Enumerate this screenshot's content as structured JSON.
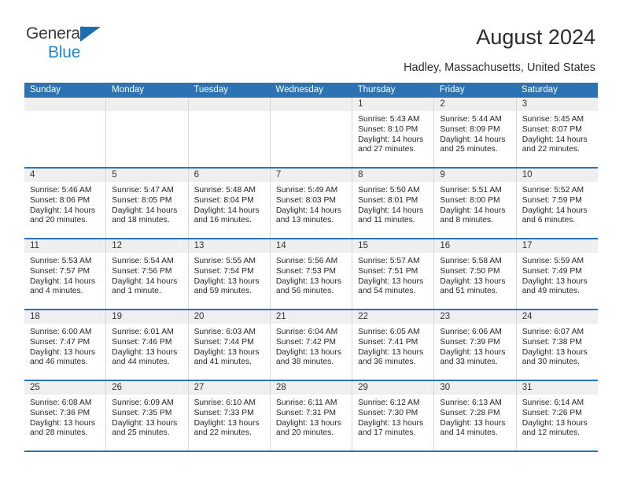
{
  "brand": {
    "name_top": "General",
    "name_bottom": "Blue",
    "accent_color": "#1e87d6",
    "triangle_color": "#1a6fb4"
  },
  "header": {
    "title": "August 2024",
    "subtitle": "Hadley, Massachusetts, United States"
  },
  "theme": {
    "header_blue": "#2b73b3",
    "daynum_band": "#efefef",
    "cell_border": "#d8d8d8"
  },
  "weekdays": [
    "Sunday",
    "Monday",
    "Tuesday",
    "Wednesday",
    "Thursday",
    "Friday",
    "Saturday"
  ],
  "weeks": [
    [
      {
        "day": "",
        "sunrise": "",
        "sunset": "",
        "daylight": ""
      },
      {
        "day": "",
        "sunrise": "",
        "sunset": "",
        "daylight": ""
      },
      {
        "day": "",
        "sunrise": "",
        "sunset": "",
        "daylight": ""
      },
      {
        "day": "",
        "sunrise": "",
        "sunset": "",
        "daylight": ""
      },
      {
        "day": "1",
        "sunrise": "Sunrise: 5:43 AM",
        "sunset": "Sunset: 8:10 PM",
        "daylight": "Daylight: 14 hours and 27 minutes."
      },
      {
        "day": "2",
        "sunrise": "Sunrise: 5:44 AM",
        "sunset": "Sunset: 8:09 PM",
        "daylight": "Daylight: 14 hours and 25 minutes."
      },
      {
        "day": "3",
        "sunrise": "Sunrise: 5:45 AM",
        "sunset": "Sunset: 8:07 PM",
        "daylight": "Daylight: 14 hours and 22 minutes."
      }
    ],
    [
      {
        "day": "4",
        "sunrise": "Sunrise: 5:46 AM",
        "sunset": "Sunset: 8:06 PM",
        "daylight": "Daylight: 14 hours and 20 minutes."
      },
      {
        "day": "5",
        "sunrise": "Sunrise: 5:47 AM",
        "sunset": "Sunset: 8:05 PM",
        "daylight": "Daylight: 14 hours and 18 minutes."
      },
      {
        "day": "6",
        "sunrise": "Sunrise: 5:48 AM",
        "sunset": "Sunset: 8:04 PM",
        "daylight": "Daylight: 14 hours and 16 minutes."
      },
      {
        "day": "7",
        "sunrise": "Sunrise: 5:49 AM",
        "sunset": "Sunset: 8:03 PM",
        "daylight": "Daylight: 14 hours and 13 minutes."
      },
      {
        "day": "8",
        "sunrise": "Sunrise: 5:50 AM",
        "sunset": "Sunset: 8:01 PM",
        "daylight": "Daylight: 14 hours and 11 minutes."
      },
      {
        "day": "9",
        "sunrise": "Sunrise: 5:51 AM",
        "sunset": "Sunset: 8:00 PM",
        "daylight": "Daylight: 14 hours and 8 minutes."
      },
      {
        "day": "10",
        "sunrise": "Sunrise: 5:52 AM",
        "sunset": "Sunset: 7:59 PM",
        "daylight": "Daylight: 14 hours and 6 minutes."
      }
    ],
    [
      {
        "day": "11",
        "sunrise": "Sunrise: 5:53 AM",
        "sunset": "Sunset: 7:57 PM",
        "daylight": "Daylight: 14 hours and 4 minutes."
      },
      {
        "day": "12",
        "sunrise": "Sunrise: 5:54 AM",
        "sunset": "Sunset: 7:56 PM",
        "daylight": "Daylight: 14 hours and 1 minute."
      },
      {
        "day": "13",
        "sunrise": "Sunrise: 5:55 AM",
        "sunset": "Sunset: 7:54 PM",
        "daylight": "Daylight: 13 hours and 59 minutes."
      },
      {
        "day": "14",
        "sunrise": "Sunrise: 5:56 AM",
        "sunset": "Sunset: 7:53 PM",
        "daylight": "Daylight: 13 hours and 56 minutes."
      },
      {
        "day": "15",
        "sunrise": "Sunrise: 5:57 AM",
        "sunset": "Sunset: 7:51 PM",
        "daylight": "Daylight: 13 hours and 54 minutes."
      },
      {
        "day": "16",
        "sunrise": "Sunrise: 5:58 AM",
        "sunset": "Sunset: 7:50 PM",
        "daylight": "Daylight: 13 hours and 51 minutes."
      },
      {
        "day": "17",
        "sunrise": "Sunrise: 5:59 AM",
        "sunset": "Sunset: 7:49 PM",
        "daylight": "Daylight: 13 hours and 49 minutes."
      }
    ],
    [
      {
        "day": "18",
        "sunrise": "Sunrise: 6:00 AM",
        "sunset": "Sunset: 7:47 PM",
        "daylight": "Daylight: 13 hours and 46 minutes."
      },
      {
        "day": "19",
        "sunrise": "Sunrise: 6:01 AM",
        "sunset": "Sunset: 7:46 PM",
        "daylight": "Daylight: 13 hours and 44 minutes."
      },
      {
        "day": "20",
        "sunrise": "Sunrise: 6:03 AM",
        "sunset": "Sunset: 7:44 PM",
        "daylight": "Daylight: 13 hours and 41 minutes."
      },
      {
        "day": "21",
        "sunrise": "Sunrise: 6:04 AM",
        "sunset": "Sunset: 7:42 PM",
        "daylight": "Daylight: 13 hours and 38 minutes."
      },
      {
        "day": "22",
        "sunrise": "Sunrise: 6:05 AM",
        "sunset": "Sunset: 7:41 PM",
        "daylight": "Daylight: 13 hours and 36 minutes."
      },
      {
        "day": "23",
        "sunrise": "Sunrise: 6:06 AM",
        "sunset": "Sunset: 7:39 PM",
        "daylight": "Daylight: 13 hours and 33 minutes."
      },
      {
        "day": "24",
        "sunrise": "Sunrise: 6:07 AM",
        "sunset": "Sunset: 7:38 PM",
        "daylight": "Daylight: 13 hours and 30 minutes."
      }
    ],
    [
      {
        "day": "25",
        "sunrise": "Sunrise: 6:08 AM",
        "sunset": "Sunset: 7:36 PM",
        "daylight": "Daylight: 13 hours and 28 minutes."
      },
      {
        "day": "26",
        "sunrise": "Sunrise: 6:09 AM",
        "sunset": "Sunset: 7:35 PM",
        "daylight": "Daylight: 13 hours and 25 minutes."
      },
      {
        "day": "27",
        "sunrise": "Sunrise: 6:10 AM",
        "sunset": "Sunset: 7:33 PM",
        "daylight": "Daylight: 13 hours and 22 minutes."
      },
      {
        "day": "28",
        "sunrise": "Sunrise: 6:11 AM",
        "sunset": "Sunset: 7:31 PM",
        "daylight": "Daylight: 13 hours and 20 minutes."
      },
      {
        "day": "29",
        "sunrise": "Sunrise: 6:12 AM",
        "sunset": "Sunset: 7:30 PM",
        "daylight": "Daylight: 13 hours and 17 minutes."
      },
      {
        "day": "30",
        "sunrise": "Sunrise: 6:13 AM",
        "sunset": "Sunset: 7:28 PM",
        "daylight": "Daylight: 13 hours and 14 minutes."
      },
      {
        "day": "31",
        "sunrise": "Sunrise: 6:14 AM",
        "sunset": "Sunset: 7:26 PM",
        "daylight": "Daylight: 13 hours and 12 minutes."
      }
    ]
  ]
}
